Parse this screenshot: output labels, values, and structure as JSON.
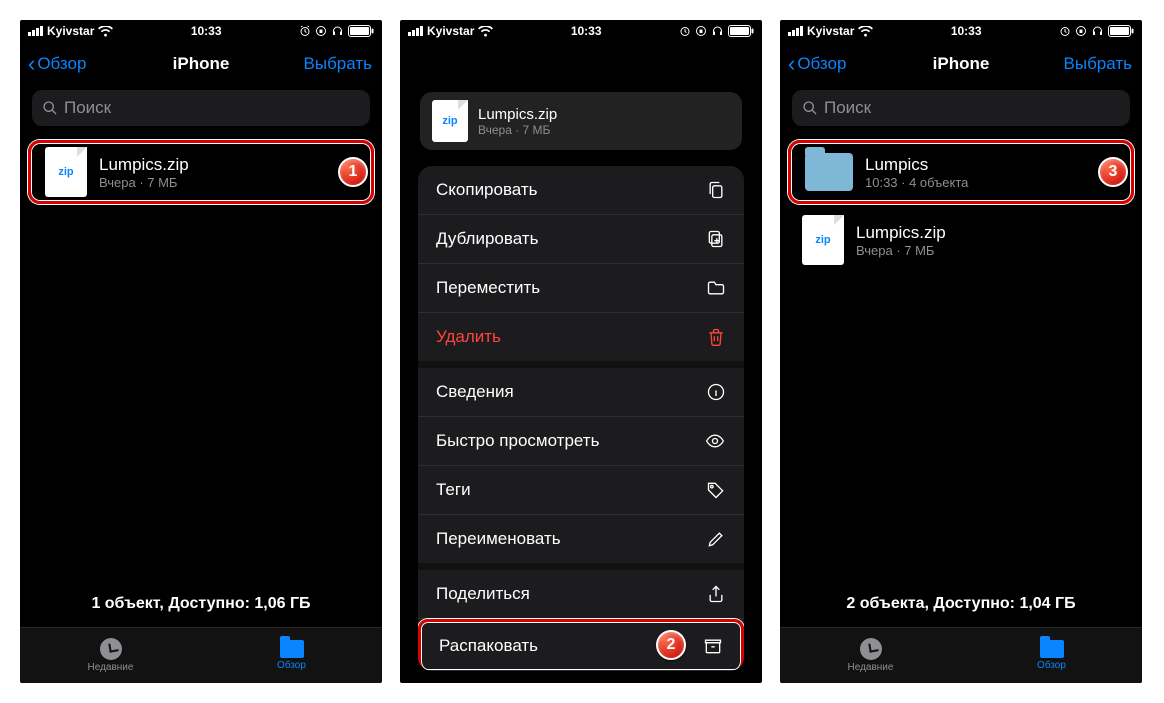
{
  "status": {
    "carrier": "Kyivstar",
    "time": "10:33"
  },
  "nav": {
    "back": "Обзор",
    "title": "iPhone",
    "select": "Выбрать"
  },
  "search_placeholder": "Поиск",
  "screen1": {
    "file": {
      "name": "Lumpics.zip",
      "sub": "Вчера · 7 МБ"
    },
    "summary": "1 объект, Доступно: 1,06 ГБ",
    "badge": "1"
  },
  "screen2": {
    "file": {
      "name": "Lumpics.zip",
      "sub": "Вчера · 7 МБ"
    },
    "menu": {
      "copy": "Скопировать",
      "duplicate": "Дублировать",
      "move": "Переместить",
      "delete": "Удалить",
      "info": "Сведения",
      "quicklook": "Быстро просмотреть",
      "tags": "Теги",
      "rename": "Переименовать",
      "share": "Поделиться",
      "unzip": "Распаковать"
    },
    "badge": "2"
  },
  "screen3": {
    "folder": {
      "name": "Lumpics",
      "sub": "10:33 · 4 объекта"
    },
    "file": {
      "name": "Lumpics.zip",
      "sub": "Вчера · 7 МБ"
    },
    "summary": "2 объекта, Доступно: 1,04 ГБ",
    "badge": "3"
  },
  "tabs": {
    "recent": "Недавние",
    "browse": "Обзор"
  }
}
